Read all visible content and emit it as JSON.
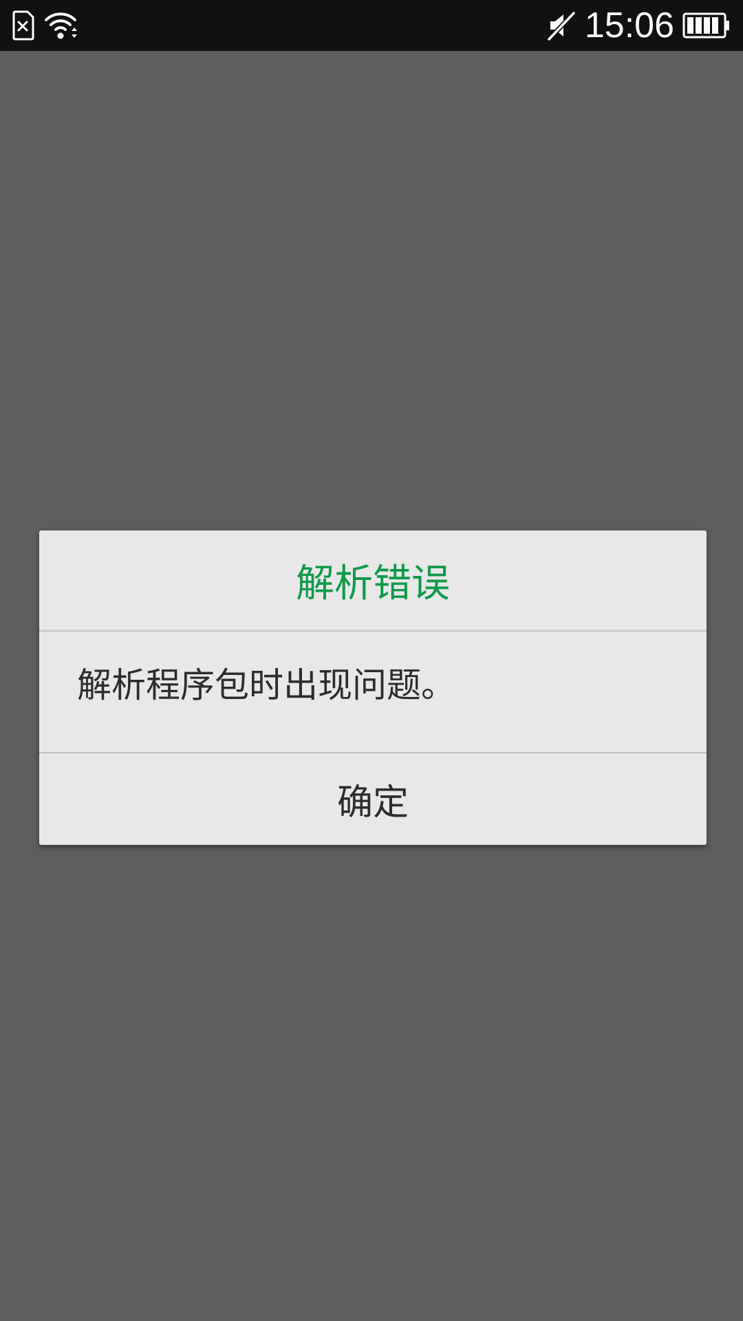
{
  "status_bar": {
    "time": "15:06",
    "icons": [
      "sim-card-missing-icon",
      "wifi-icon",
      "mute-icon",
      "battery-icon"
    ]
  },
  "dialog": {
    "title": "解析错误",
    "message": "解析程序包时出现问题。",
    "ok_label": "确定",
    "title_color": "#0f9a4a"
  },
  "colors": {
    "backdrop": "#5e5e5e",
    "status_bar": "#111111",
    "dialog_bg": "#e8e8e8"
  }
}
